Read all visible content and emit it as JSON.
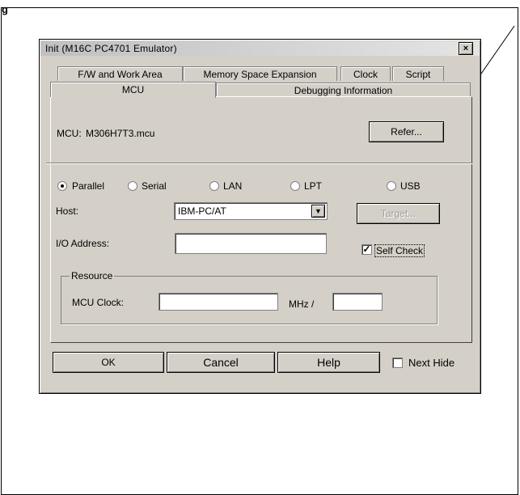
{
  "page_label": "g",
  "dialog": {
    "title": "Init (M16C PC4701 Emulator)",
    "close_glyph": "×",
    "tabs_row1": [
      "F/W and Work Area",
      "Memory Space Expansion",
      "Clock",
      "Script"
    ],
    "tabs_row2": [
      "MCU",
      "Debugging Information"
    ],
    "mcu": {
      "label": "MCU:",
      "value": "M306H7T3.mcu",
      "refer_label": "Refer..."
    },
    "interfaces": [
      {
        "label": "Parallel",
        "selected": true
      },
      {
        "label": "Serial",
        "selected": false
      },
      {
        "label": "LAN",
        "selected": false
      },
      {
        "label": "LPT",
        "selected": false
      },
      {
        "label": "USB",
        "selected": false
      }
    ],
    "host": {
      "label": "Host:",
      "value": "IBM-PC/AT",
      "arrow": "▼"
    },
    "target_label": "Target...",
    "io_address": {
      "label": "I/O Address:",
      "value": ""
    },
    "self_check": {
      "label": "Self Check",
      "checked": true,
      "mark": "✓"
    },
    "resource": {
      "legend": "Resource",
      "mcu_clock_label": "MCU Clock:",
      "mcu_clock_value": "",
      "unit": "MHz /",
      "divider_value": ""
    },
    "buttons": {
      "ok": "OK",
      "cancel": "Cancel",
      "help": "Help"
    },
    "next_hide": {
      "label": "Next Hide",
      "checked": false
    }
  }
}
